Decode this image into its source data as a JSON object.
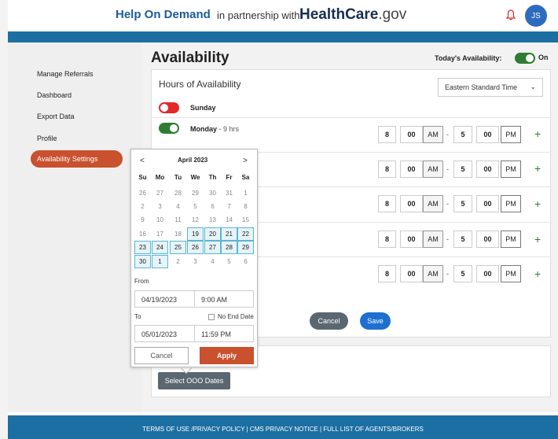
{
  "header": {
    "brand": "Help On Demand",
    "partner_text": "in partnership with",
    "partner_brand_bold": "HealthCare",
    "partner_brand_suffix": ".gov",
    "avatar_initials": "JS",
    "bell_icon": "bell-icon"
  },
  "sidebar": {
    "items": [
      {
        "label": "Manage Referrals"
      },
      {
        "label": "Dashboard"
      },
      {
        "label": "Export Data"
      },
      {
        "label": "Profile"
      },
      {
        "label": "Availability Settings",
        "active": true
      }
    ]
  },
  "page": {
    "title": "Availability",
    "today_label": "Today's Availability:",
    "today_state": "On"
  },
  "hours": {
    "title": "Hours of Availability",
    "timezone": "Eastern Standard Time",
    "days": [
      {
        "name": "Sunday",
        "enabled": false,
        "hrs": "",
        "start_h": "",
        "start_m": "",
        "start_ampm": "",
        "end_h": "",
        "end_m": "",
        "end_ampm": ""
      },
      {
        "name": "Monday",
        "enabled": true,
        "hrs": " - 9 hrs",
        "start_h": "8",
        "start_m": "00",
        "start_ampm": "AM",
        "end_h": "5",
        "end_m": "00",
        "end_ampm": "PM"
      },
      {
        "name": "",
        "enabled": true,
        "hrs": "",
        "start_h": "8",
        "start_m": "00",
        "start_ampm": "AM",
        "end_h": "5",
        "end_m": "00",
        "end_ampm": "PM"
      },
      {
        "name": "",
        "enabled": true,
        "hrs": "",
        "start_h": "8",
        "start_m": "00",
        "start_ampm": "AM",
        "end_h": "5",
        "end_m": "00",
        "end_ampm": "PM"
      },
      {
        "name": "",
        "enabled": true,
        "hrs": "",
        "start_h": "8",
        "start_m": "00",
        "start_ampm": "AM",
        "end_h": "5",
        "end_m": "00",
        "end_ampm": "PM"
      },
      {
        "name": "",
        "enabled": true,
        "hrs": "",
        "start_h": "8",
        "start_m": "00",
        "start_ampm": "AM",
        "end_h": "5",
        "end_m": "00",
        "end_ampm": "PM"
      }
    ],
    "separator": "-",
    "add_symbol": "+",
    "cancel_label": "Cancel",
    "save_label": "Save"
  },
  "ooo": {
    "button_label": "Select OOO Dates"
  },
  "calendar": {
    "prev": "<",
    "next": ">",
    "month": "April 2023",
    "dow": [
      "Su",
      "Mo",
      "Tu",
      "We",
      "Th",
      "Fr",
      "Sa"
    ],
    "weeks": [
      [
        {
          "d": "26",
          "cur": false
        },
        {
          "d": "27",
          "cur": false
        },
        {
          "d": "28",
          "cur": false
        },
        {
          "d": "29",
          "cur": false
        },
        {
          "d": "30",
          "cur": false
        },
        {
          "d": "31",
          "cur": false
        },
        {
          "d": "1",
          "cur": false
        }
      ],
      [
        {
          "d": "2",
          "cur": false
        },
        {
          "d": "3",
          "cur": false
        },
        {
          "d": "4",
          "cur": false
        },
        {
          "d": "5",
          "cur": false
        },
        {
          "d": "6",
          "cur": false
        },
        {
          "d": "7",
          "cur": false
        },
        {
          "d": "8",
          "cur": false
        }
      ],
      [
        {
          "d": "9",
          "cur": false
        },
        {
          "d": "10",
          "cur": false
        },
        {
          "d": "11",
          "cur": false
        },
        {
          "d": "12",
          "cur": false
        },
        {
          "d": "13",
          "cur": false
        },
        {
          "d": "14",
          "cur": false
        },
        {
          "d": "15",
          "cur": false
        }
      ],
      [
        {
          "d": "16",
          "cur": false
        },
        {
          "d": "17",
          "cur": false
        },
        {
          "d": "18",
          "cur": false
        },
        {
          "d": "19",
          "cur": true,
          "sel": true
        },
        {
          "d": "20",
          "cur": true,
          "sel": true
        },
        {
          "d": "21",
          "cur": true,
          "sel": true
        },
        {
          "d": "22",
          "cur": true,
          "sel": true
        }
      ],
      [
        {
          "d": "23",
          "cur": true,
          "sel": true
        },
        {
          "d": "24",
          "cur": true,
          "sel": true
        },
        {
          "d": "25",
          "cur": true,
          "sel": true
        },
        {
          "d": "26",
          "cur": true,
          "sel": true
        },
        {
          "d": "27",
          "cur": true,
          "sel": true
        },
        {
          "d": "28",
          "cur": true,
          "sel": true
        },
        {
          "d": "29",
          "cur": true,
          "sel": true
        }
      ],
      [
        {
          "d": "30",
          "cur": true,
          "sel": true
        },
        {
          "d": "1",
          "cur": true,
          "sel": true
        },
        {
          "d": "2",
          "cur": false
        },
        {
          "d": "3",
          "cur": false
        },
        {
          "d": "4",
          "cur": false
        },
        {
          "d": "5",
          "cur": false
        },
        {
          "d": "6",
          "cur": false
        }
      ]
    ],
    "from_label": "From",
    "from_date": "04/19/2023",
    "from_time": "9:00 AM",
    "to_label": "To",
    "no_end_label": "No End Date",
    "to_date": "05/01/2023",
    "to_time": "11:59 PM",
    "cancel_label": "Cancel",
    "apply_label": "Apply"
  },
  "footer": {
    "text": "TERMS OF USE /PRIVACY POLICY | CMS PRIVACY NOTICE | FULL LIST OF AGENTS/BROKERS"
  },
  "colors": {
    "brand_blue": "#1d5b9a",
    "bar_blue": "#1c6fa3",
    "accent_orange": "#c9512e",
    "toggle_on": "#2e7d32",
    "toggle_off": "#e5262b",
    "save_blue": "#1f6fd1"
  }
}
